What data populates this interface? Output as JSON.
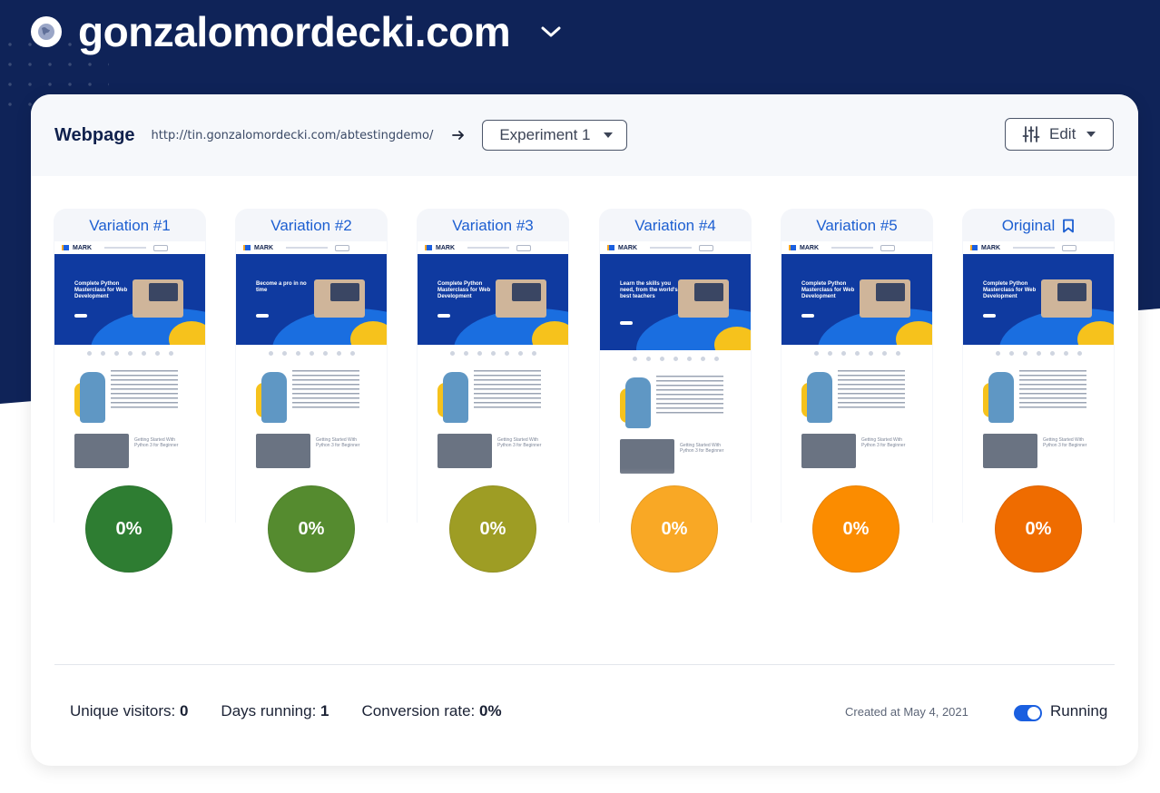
{
  "site": {
    "title": "gonzalomordecki.com",
    "icon": "globe-icon",
    "menu_icon": "chevron-down-icon"
  },
  "header": {
    "webpage_label": "Webpage",
    "url": "http://tin.gonzalomordecki.com/abtestingdemo/",
    "experiment": "Experiment 1",
    "edit_label": "Edit"
  },
  "variations": [
    {
      "title": "Variation #1",
      "rate": "0%",
      "color": "#2e7d32",
      "hero": "Complete Python Masterclass for Web Development"
    },
    {
      "title": "Variation #2",
      "rate": "0%",
      "color": "#558b2f",
      "hero": "Become a pro in no time"
    },
    {
      "title": "Variation #3",
      "rate": "0%",
      "color": "#9e9d24",
      "hero": "Complete Python Masterclass for Web Development"
    },
    {
      "title": "Variation #4",
      "rate": "0%",
      "color": "#f9a825",
      "hero": "Learn the skills you need, from the world's best teachers"
    },
    {
      "title": "Variation #5",
      "rate": "0%",
      "color": "#fb8c00",
      "hero": "Complete Python Masterclass for Web Development"
    },
    {
      "title": "Original",
      "rate": "0%",
      "color": "#ef6c00",
      "hero": "Complete Python Masterclass for Web Development"
    }
  ],
  "thumbnail": {
    "brand": "MARK",
    "course_title": "Getting Started With Python 3 for Beginner"
  },
  "stats": {
    "visitors_label": "Unique visitors:",
    "visitors": "0",
    "days_label": "Days running:",
    "days": "1",
    "conversion_label": "Conversion rate:",
    "conversion": "0%",
    "created": "Created at May 4, 2021",
    "status": "Running"
  },
  "colors": {
    "navy": "#0f2358",
    "accent": "#1a5fe0"
  }
}
